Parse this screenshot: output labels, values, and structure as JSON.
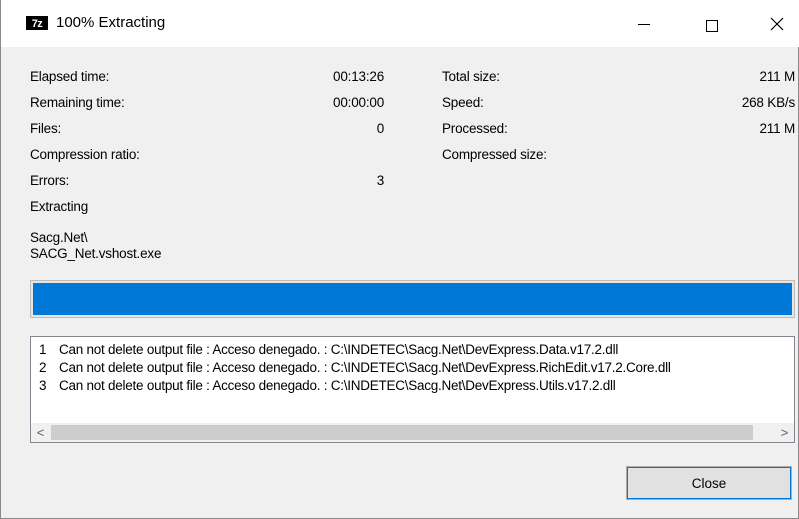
{
  "window": {
    "title": "100% Extracting",
    "icon_text": "7z",
    "icon": "7zip-icon"
  },
  "controls": {
    "minimize": "—",
    "close": "✕"
  },
  "stats_left": [
    {
      "label": "Elapsed time:",
      "value": "00:13:26"
    },
    {
      "label": "Remaining time:",
      "value": "00:00:00"
    },
    {
      "label": "Files:",
      "value": "0"
    },
    {
      "label": "Compression ratio:",
      "value": ""
    },
    {
      "label": "Errors:",
      "value": "3"
    }
  ],
  "stats_right": [
    {
      "label": "Total size:",
      "value": "211 M"
    },
    {
      "label": "Speed:",
      "value": "268 KB/s"
    },
    {
      "label": "Processed:",
      "value": "211 M"
    },
    {
      "label": "Compressed size:",
      "value": ""
    }
  ],
  "status": {
    "operation": "Extracting",
    "path_line1": "Sacg.Net\\",
    "path_line2": "SACG_Net.vshost.exe"
  },
  "progress": {
    "fraction": 1.0,
    "color": "#0078d7"
  },
  "log": {
    "messages": [
      {
        "num": "1",
        "text": "Can not delete output file : Acceso denegado. : C:\\INDETEC\\Sacg.Net\\DevExpress.Data.v17.2.dll"
      },
      {
        "num": "2",
        "text": "Can not delete output file : Acceso denegado. : C:\\INDETEC\\Sacg.Net\\DevExpress.RichEdit.v17.2.Core.dll"
      },
      {
        "num": "3",
        "text": "Can not delete output file : Acceso denegado. : C:\\INDETEC\\Sacg.Net\\DevExpress.Utils.v17.2.dll"
      }
    ],
    "scroll_left": "<",
    "scroll_right": ">"
  },
  "buttons": {
    "close_label": "Close"
  }
}
